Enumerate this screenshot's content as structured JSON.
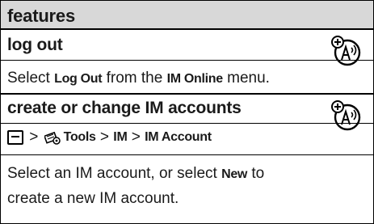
{
  "header": {
    "title": "features"
  },
  "sections": [
    {
      "title": "log out",
      "icon": "network-service-icon",
      "line1": {
        "pre": "Select ",
        "bold1": "Log Out",
        "mid": " from the ",
        "bold2": "IM Online",
        "post": " menu."
      }
    },
    {
      "title": "create or change IM accounts",
      "icon": "network-service-icon",
      "path": {
        "sep1": " > ",
        "tools": "Tools",
        "sep2": " > ",
        "im": "IM",
        "sep3": " > ",
        "account": "IM Account"
      },
      "line1": {
        "pre": "Select an IM account, or select ",
        "bold1": "New",
        "post": " to"
      },
      "line2": "create a new IM account."
    }
  ]
}
